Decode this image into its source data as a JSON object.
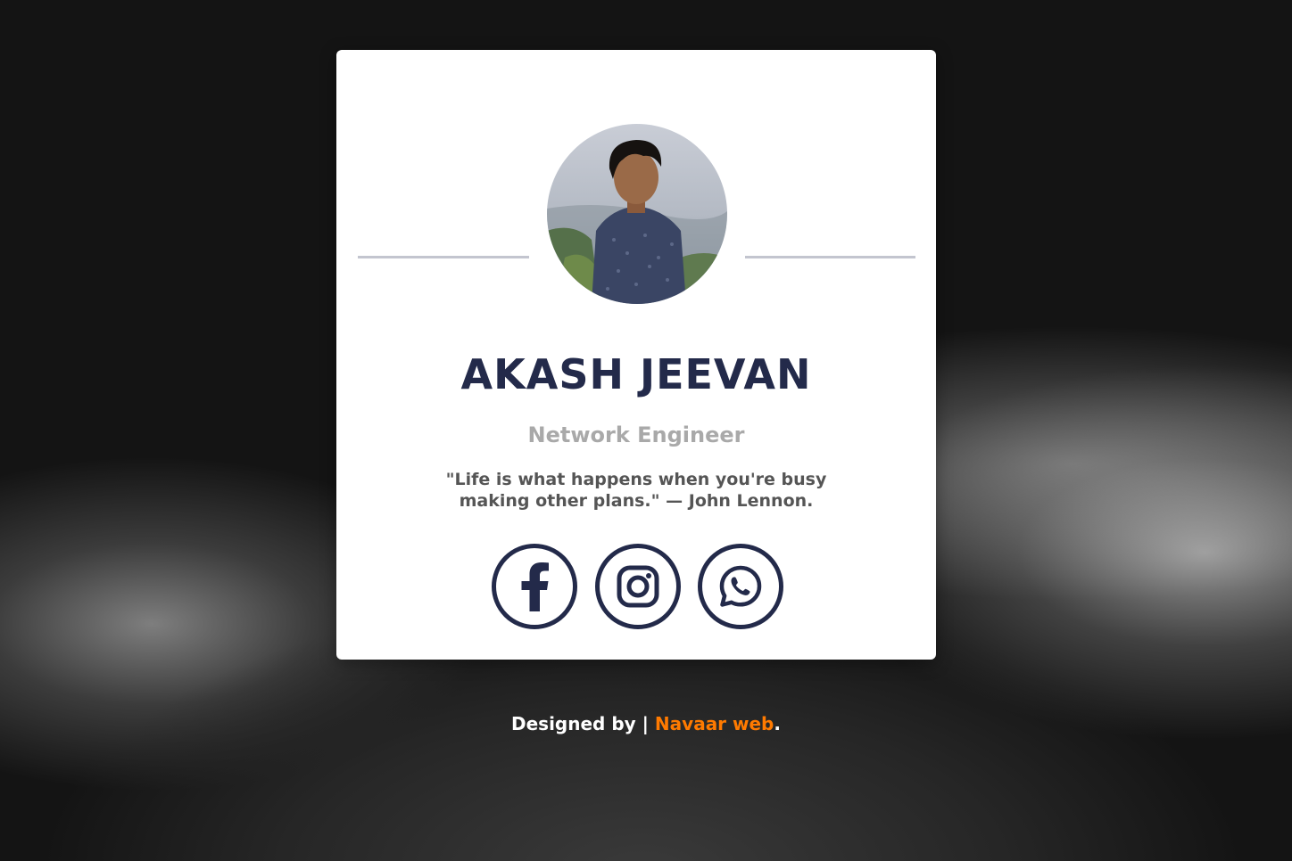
{
  "profile": {
    "name": "AKASH JEEVAN",
    "title": "Network Engineer",
    "quote": "\"Life is what happens when you're busy making other plans.\" — John Lennon."
  },
  "socials": [
    {
      "icon": "facebook-icon"
    },
    {
      "icon": "instagram-icon"
    },
    {
      "icon": "whatsapp-icon"
    }
  ],
  "footer": {
    "prefix": "Designed by | ",
    "link": "Navaar web",
    "suffix": "."
  },
  "colors": {
    "accent": "#232a4a",
    "link": "#ff7a00",
    "subtitle": "#a9a9a9",
    "divider": "#c3c5cf"
  }
}
